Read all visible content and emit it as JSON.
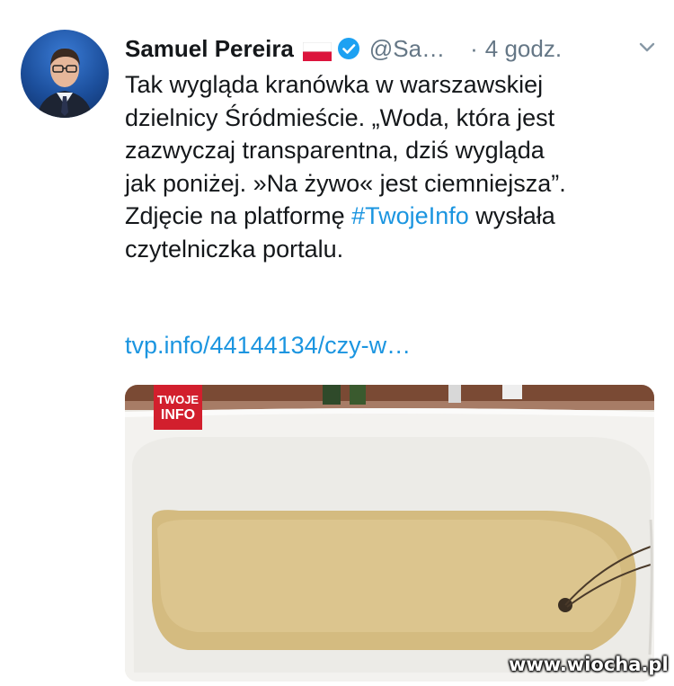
{
  "tweet": {
    "author_name": "Samuel Pereira",
    "handle": "@Sa…",
    "separator": "·",
    "time": "4 godz.",
    "text_lines": [
      "Tak wygląda kranówka w warszawskiej",
      "dzielnicy Śródmieście. „Woda, która jest",
      "zazwyczaj transparentna, dziś wygląda",
      "jak poniżej. »Na żywo« jest ciemniejsza”."
    ],
    "line5_prefix": "Zdjęcie na platformę",
    "hashtag": "#TwojeInfo",
    "line5_suffix": "wysłała",
    "line6": "czytelniczka portalu.",
    "link": "tvp.info/44144134/czy-w…"
  },
  "icons": {
    "flag": "poland-flag-icon",
    "verified": "verified-badge-icon",
    "menu": "chevron-down-icon"
  },
  "media": {
    "badge_line1": "TWOJE",
    "badge_line2": "INFO"
  },
  "watermark": "www.wiocha.pl",
  "colors": {
    "link": "#1b95e0",
    "text": "#14171a",
    "secondary": "#657786",
    "verified": "#1da1f2",
    "badge": "#d21f2d"
  }
}
